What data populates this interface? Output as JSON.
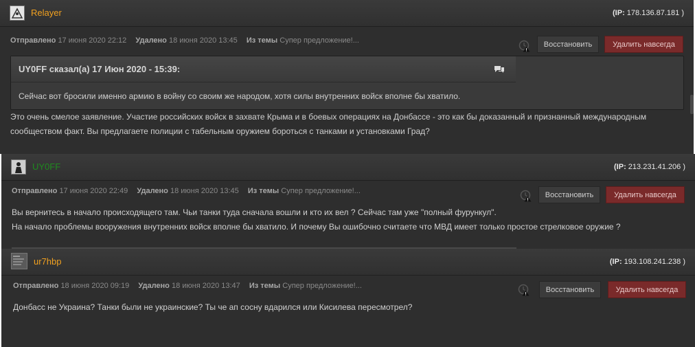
{
  "posts": [
    {
      "username": "Relayer",
      "username_color": "#f0a020",
      "ip_label": "(IP: ",
      "ip": "178.136.87.181",
      "ip_close": " )",
      "sent_label": "Отправлено",
      "sent_date": "17 июня 2020 22:12",
      "deleted_label": "Удалено",
      "deleted_date": "18 июня 2020 13:45",
      "topic_label": "Из темы",
      "topic": "Супер предложение!...",
      "restore_label": "Восстановить",
      "delete_label": "Удалить навсегда",
      "quote": {
        "title": "UY0FF сказал(а) 17 Июн 2020 - 15:39:",
        "text": "Сейчас вот бросили именно армию в войну со своим же народом, хотя силы внутренних войск вполне бы хватило."
      },
      "body_lines": [
        "Это очень смелое заявление. Участие российских войск в захвате Крыма и в боевых операциях на Донбассе - это как бы доказанный и признанный международным",
        "сообществом факт. Вы предлагаете полиции с табельным оружием бороться с танками и установками Град?"
      ]
    },
    {
      "username": "UY0FF",
      "username_color": "#1f8a1f",
      "ip_label": "(IP: ",
      "ip": "213.231.41.206",
      "ip_close": " )",
      "sent_label": "Отправлено",
      "sent_date": "17 июня 2020 22:49",
      "deleted_label": "Удалено",
      "deleted_date": "18 июня 2020 13:45",
      "topic_label": "Из темы",
      "topic": "Супер предложение!...",
      "restore_label": "Восстановить",
      "delete_label": "Удалить навсегда",
      "body_lines": [
        "Вы вернитесь в начало происходящего там. Чьи танки туда сначала вошли и кто их вел ? Сейчас там уже \"полный фурункул\".",
        "На начало проблемы вооружения внутренних войск вполне бы хватило. И почему Вы ошибочно считаете что МВД имеет только простое стрелковое оружие ?"
      ]
    },
    {
      "username": "ur7hbp",
      "username_color": "#f0a020",
      "ip_label": "(IP: ",
      "ip": "193.108.241.238",
      "ip_close": " )",
      "sent_label": "Отправлено",
      "sent_date": "18 июня 2020 09:19",
      "deleted_label": "Удалено",
      "deleted_date": "18 июня 2020 13:47",
      "topic_label": "Из темы",
      "topic": "Супер предложение!...",
      "restore_label": "Восстановить",
      "delete_label": "Удалить навсегда",
      "body_lines": [
        "Донбасс не Украина? Танки были не украинские? Ты че ап сосну вдарился или Кисилева пересмотрел?"
      ]
    }
  ]
}
